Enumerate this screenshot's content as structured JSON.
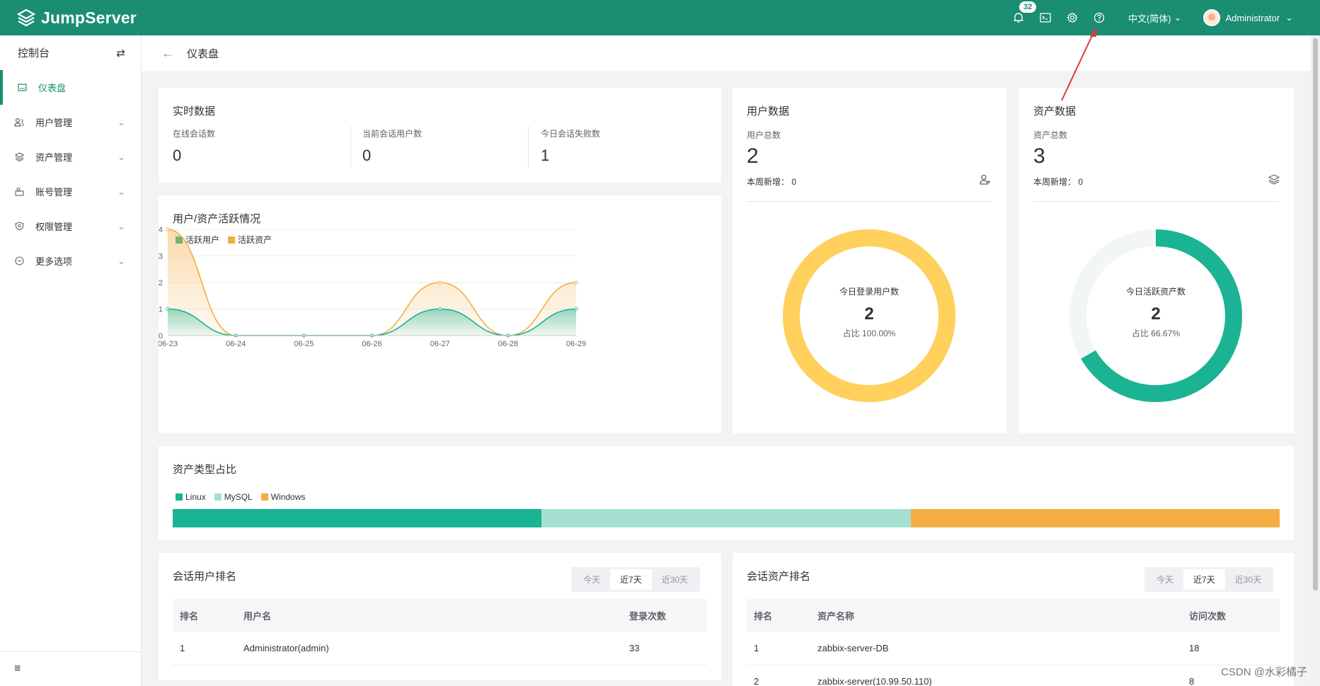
{
  "app": {
    "name": "JumpServer",
    "brand_color": "#1a8d72"
  },
  "topbar": {
    "notification_count": "32",
    "language": "中文(简体)",
    "user": "Administrator",
    "icons": [
      "bell-icon",
      "terminal-icon",
      "gear-icon",
      "help-icon"
    ]
  },
  "sidebar": {
    "title": "控制台",
    "items": [
      {
        "label": "仪表盘",
        "icon": "dashboard-icon",
        "active": true
      },
      {
        "label": "用户管理",
        "icon": "users-icon"
      },
      {
        "label": "资产管理",
        "icon": "assets-icon"
      },
      {
        "label": "账号管理",
        "icon": "account-icon"
      },
      {
        "label": "权限管理",
        "icon": "shield-icon"
      },
      {
        "label": "更多选项",
        "icon": "more-icon"
      }
    ]
  },
  "breadcrumb": {
    "title": "仪表盘"
  },
  "realtime": {
    "title": "实时数据",
    "stats": [
      {
        "label": "在线会话数",
        "value": "0"
      },
      {
        "label": "当前会话用户数",
        "value": "0"
      },
      {
        "label": "今日会话失败数",
        "value": "1"
      }
    ]
  },
  "user_data": {
    "title": "用户数据",
    "total_label": "用户总数",
    "total": "2",
    "weekly": "本周新增： 0",
    "donut_label": "今日登录用户数",
    "donut_value": "2",
    "donut_ratio": "占比 100.00%",
    "donut_fraction": 1.0,
    "donut_color": "#ffd15c"
  },
  "asset_data": {
    "title": "资产数据",
    "total_label": "资产总数",
    "total": "3",
    "weekly": "本周新增： 0",
    "donut_label": "今日活跃资产数",
    "donut_value": "2",
    "donut_ratio": "占比 66.67%",
    "donut_fraction": 0.6667,
    "donut_color": "#1ab394"
  },
  "activity": {
    "title": "用户/资产活跃情况"
  },
  "chart_data": {
    "type": "area",
    "categories": [
      "06-23",
      "06-24",
      "06-25",
      "06-26",
      "06-27",
      "06-28",
      "06-29"
    ],
    "series": [
      {
        "name": "活跃用户",
        "values": [
          1,
          0,
          0,
          0,
          1,
          0,
          1
        ],
        "color": "#1ab394"
      },
      {
        "name": "活跃资产",
        "values": [
          4,
          0,
          0,
          0,
          2,
          0,
          2
        ],
        "color": "#f4ad42"
      }
    ],
    "yticks": [
      "0",
      "1",
      "2",
      "3",
      "4"
    ],
    "ylim": [
      0,
      4
    ],
    "legend": "top-left"
  },
  "asset_types": {
    "title": "资产类型占比",
    "items": [
      {
        "name": "Linux",
        "fraction": 0.3333,
        "color": "#1ab394"
      },
      {
        "name": "MySQL",
        "fraction": 0.3333,
        "color": "#a6e0d2"
      },
      {
        "name": "Windows",
        "fraction": 0.3334,
        "color": "#f4ad42"
      }
    ]
  },
  "session_users": {
    "title": "会话用户排名",
    "tabs": [
      "今天",
      "近7天",
      "近30天"
    ],
    "columns": [
      "排名",
      "用户名",
      "登录次数"
    ],
    "rows": [
      [
        "1",
        "Administrator(admin)",
        "33"
      ]
    ]
  },
  "session_assets": {
    "title": "会话资产排名",
    "tabs": [
      "今天",
      "近7天",
      "近30天"
    ],
    "columns": [
      "排名",
      "资产名称",
      "访问次数"
    ],
    "rows": [
      [
        "1",
        "zabbix-server-DB",
        "18"
      ],
      [
        "2",
        "zabbix-server(10.99.50.110)",
        "8"
      ]
    ]
  },
  "watermark": "CSDN @水彩橘子"
}
